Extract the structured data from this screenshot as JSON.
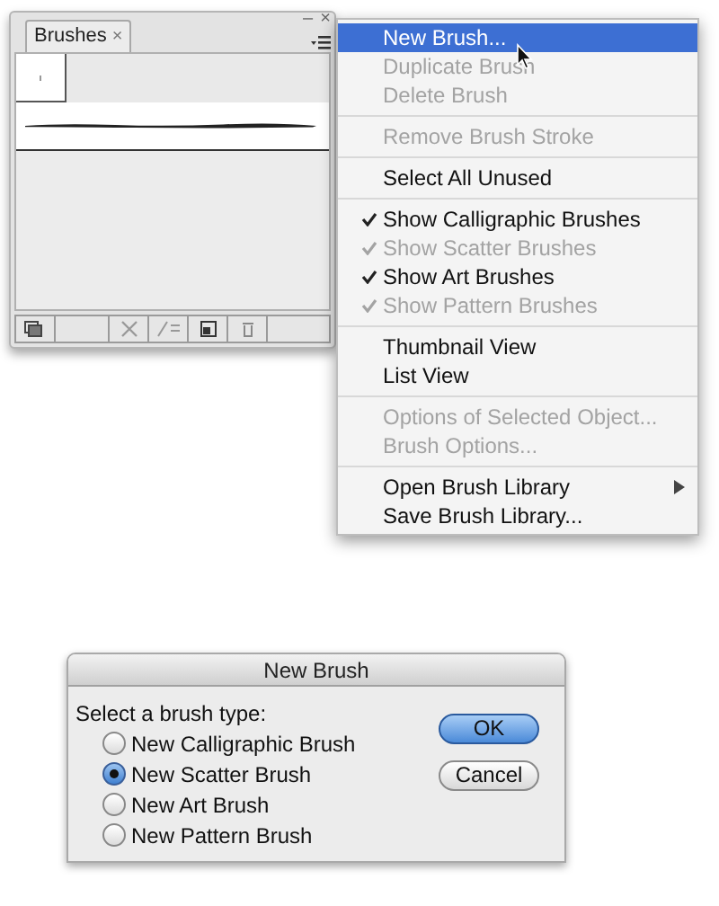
{
  "panel": {
    "tab": {
      "label": "Brushes",
      "close": "×"
    },
    "minimize": "–",
    "close": "×"
  },
  "menu": {
    "groups": [
      [
        {
          "label": "New Brush...",
          "disabled": false,
          "selected": true,
          "checked": false,
          "submenu": false
        },
        {
          "label": "Duplicate Brush",
          "disabled": true,
          "selected": false,
          "checked": false,
          "submenu": false
        },
        {
          "label": "Delete Brush",
          "disabled": true,
          "selected": false,
          "checked": false,
          "submenu": false
        }
      ],
      [
        {
          "label": "Remove Brush Stroke",
          "disabled": true,
          "selected": false,
          "checked": false,
          "submenu": false
        }
      ],
      [
        {
          "label": "Select All Unused",
          "disabled": false,
          "selected": false,
          "checked": false,
          "submenu": false
        }
      ],
      [
        {
          "label": "Show Calligraphic Brushes",
          "disabled": false,
          "selected": false,
          "checked": true,
          "submenu": false
        },
        {
          "label": "Show Scatter Brushes",
          "disabled": true,
          "selected": false,
          "checked": true,
          "submenu": false
        },
        {
          "label": "Show Art Brushes",
          "disabled": false,
          "selected": false,
          "checked": true,
          "submenu": false
        },
        {
          "label": "Show Pattern Brushes",
          "disabled": true,
          "selected": false,
          "checked": true,
          "submenu": false
        }
      ],
      [
        {
          "label": "Thumbnail View",
          "disabled": false,
          "selected": false,
          "checked": false,
          "submenu": false
        },
        {
          "label": "List View",
          "disabled": false,
          "selected": false,
          "checked": false,
          "submenu": false
        }
      ],
      [
        {
          "label": "Options of Selected Object...",
          "disabled": true,
          "selected": false,
          "checked": false,
          "submenu": false
        },
        {
          "label": "Brush Options...",
          "disabled": true,
          "selected": false,
          "checked": false,
          "submenu": false
        }
      ],
      [
        {
          "label": "Open Brush Library",
          "disabled": false,
          "selected": false,
          "checked": false,
          "submenu": true
        },
        {
          "label": "Save Brush Library...",
          "disabled": false,
          "selected": false,
          "checked": false,
          "submenu": false
        }
      ]
    ]
  },
  "dialog": {
    "title": "New Brush",
    "prompt": "Select a brush type:",
    "options": [
      {
        "label": "New Calligraphic Brush",
        "selected": false
      },
      {
        "label": "New Scatter Brush",
        "selected": true
      },
      {
        "label": "New Art Brush",
        "selected": false
      },
      {
        "label": "New Pattern Brush",
        "selected": false
      }
    ],
    "buttons": [
      {
        "label": "OK",
        "default": true
      },
      {
        "label": "Cancel",
        "default": false
      }
    ]
  }
}
